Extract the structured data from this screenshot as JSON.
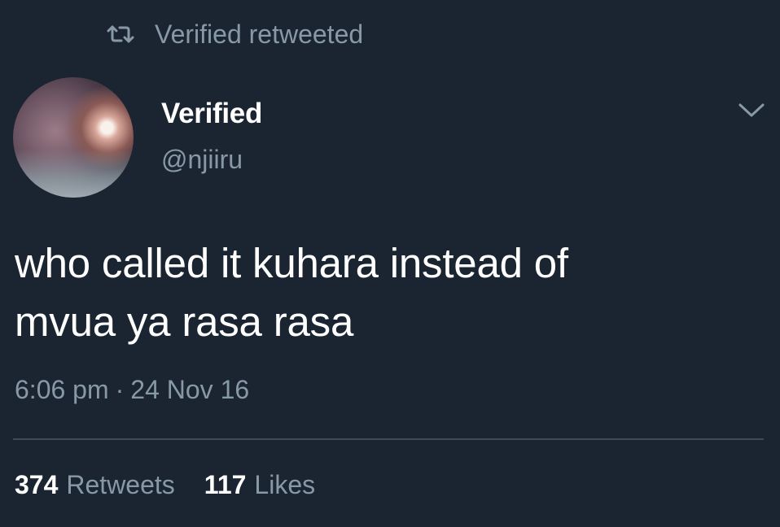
{
  "retweet_context": {
    "icon": "retweet-icon",
    "text": "Verified retweeted"
  },
  "author": {
    "display_name": "Verified",
    "handle": "@njiiru",
    "avatar": "avatar-photo"
  },
  "menu_icon": "chevron-down-icon",
  "tweet": {
    "text_line1": "who called it kuhara instead of",
    "text_line2": "mvua ya rasa rasa",
    "time": "6:06 pm",
    "separator": "·",
    "date": "24 Nov 16"
  },
  "stats": {
    "retweets_count": "374",
    "retweets_label": "Retweets",
    "likes_count": "117",
    "likes_label": "Likes"
  },
  "colors": {
    "background": "#1b2532",
    "primary_text": "#ffffff",
    "secondary_text": "#8899a6",
    "divider": "#3d4a57"
  }
}
